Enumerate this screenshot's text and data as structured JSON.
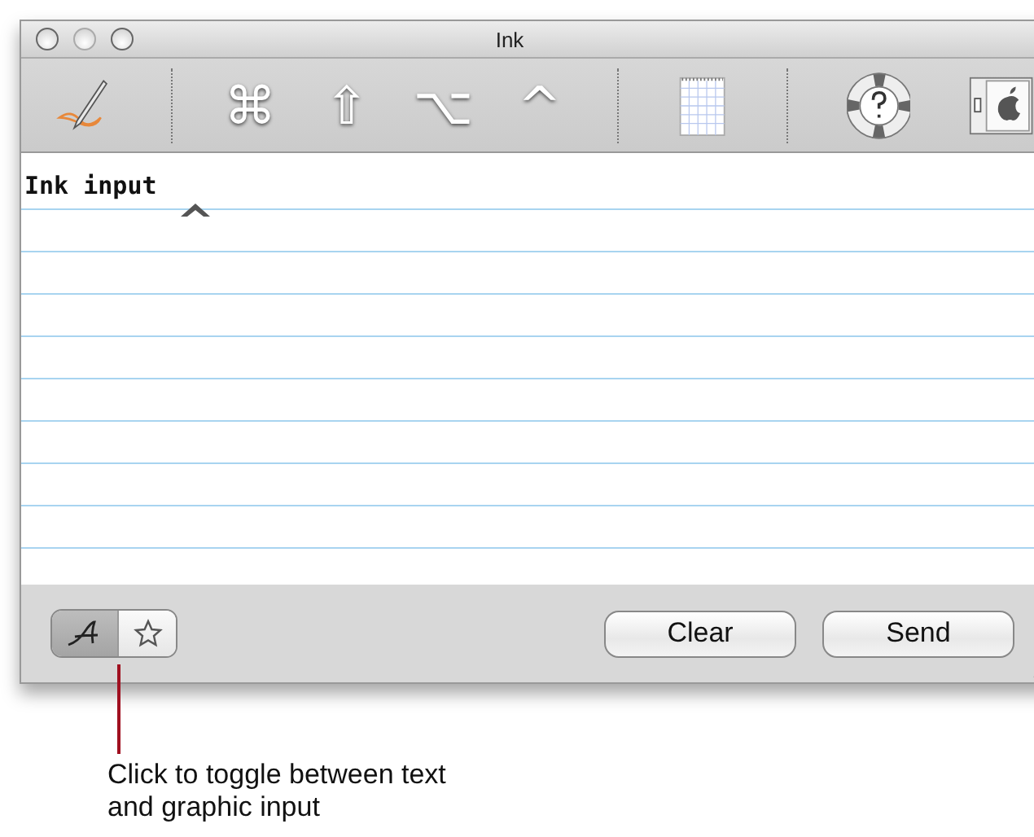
{
  "window": {
    "title": "Ink"
  },
  "toolbar": [
    {
      "kind": "pen"
    },
    {
      "kind": "separator"
    },
    {
      "kind": "key",
      "label": "⌘"
    },
    {
      "kind": "key",
      "label": "⇧"
    },
    {
      "kind": "key",
      "label": "⌥"
    },
    {
      "kind": "key",
      "label": "^"
    },
    {
      "kind": "separator"
    },
    {
      "kind": "notepad"
    },
    {
      "kind": "separator"
    },
    {
      "kind": "help"
    },
    {
      "kind": "apple"
    }
  ],
  "ink_text": "Ink input",
  "mode_toggle": [
    {
      "kind": "text",
      "selected": true
    },
    {
      "kind": "graphic",
      "selected": false
    }
  ],
  "buttons": [
    "Clear",
    "Send"
  ],
  "callout": "Click to toggle between text and graphic input"
}
